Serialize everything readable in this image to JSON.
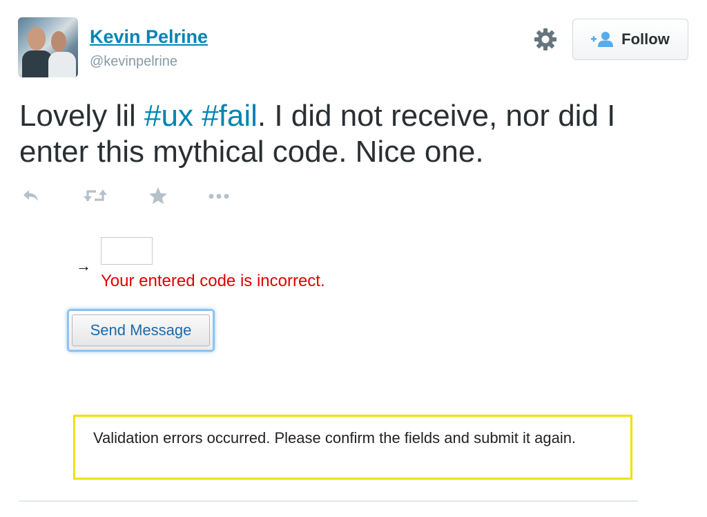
{
  "author": {
    "name": "Kevin Pelrine",
    "handle": "@kevinpelrine"
  },
  "header": {
    "follow_label": "Follow"
  },
  "tweet": {
    "text_before": "Lovely lil ",
    "hashtag1": "#ux",
    "between": " ",
    "hashtag2": "#fail",
    "text_after": ". I did not receive, nor did I enter this mythical code. Nice one."
  },
  "actions": {
    "icons": [
      "reply-icon",
      "retweet-icon",
      "favorite-icon",
      "more-icon"
    ]
  },
  "embedded_screenshot": {
    "arrow": "→",
    "code_input_value": "",
    "error_message": "Your entered code is incorrect.",
    "send_button_label": "Send Message",
    "validation_message": "Validation errors occurred. Please confirm the fields and submit it again."
  },
  "colors": {
    "link": "#0084b4",
    "text": "#292f33",
    "muted": "#8899a6",
    "error": "#e00000",
    "highlight_border": "#f0e000",
    "focus_glow": "#8fc3f2"
  }
}
